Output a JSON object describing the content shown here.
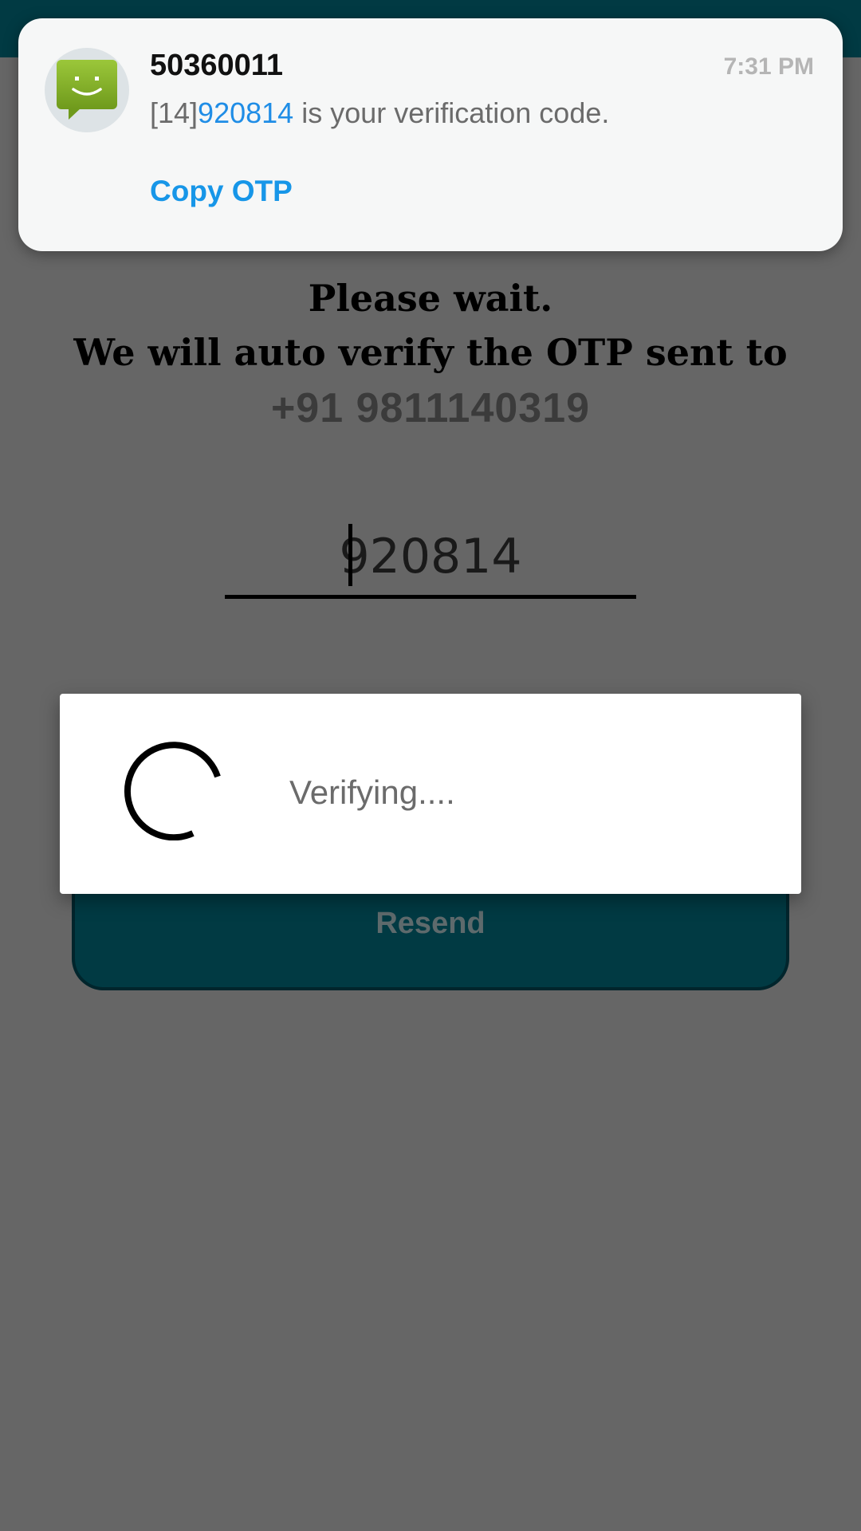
{
  "notification": {
    "sender": "50360011",
    "time": "7:31 PM",
    "message_prefix": "[14]",
    "message_code": "920814",
    "message_suffix": " is your verification code.",
    "action_label": "Copy OTP",
    "icon": "sms-smiley-icon"
  },
  "instruction": {
    "line1": "Please wait.",
    "line2": "We will auto verify the OTP sent to",
    "phone": "+91 9811140319"
  },
  "otp_field": {
    "value": "920814"
  },
  "dialog": {
    "message": "Verifying....",
    "icon": "loading-spinner-icon"
  },
  "resend_button": {
    "label": "Resend"
  },
  "colors": {
    "header": "#013a43",
    "scrim": "#666666",
    "link": "#1796e8"
  }
}
